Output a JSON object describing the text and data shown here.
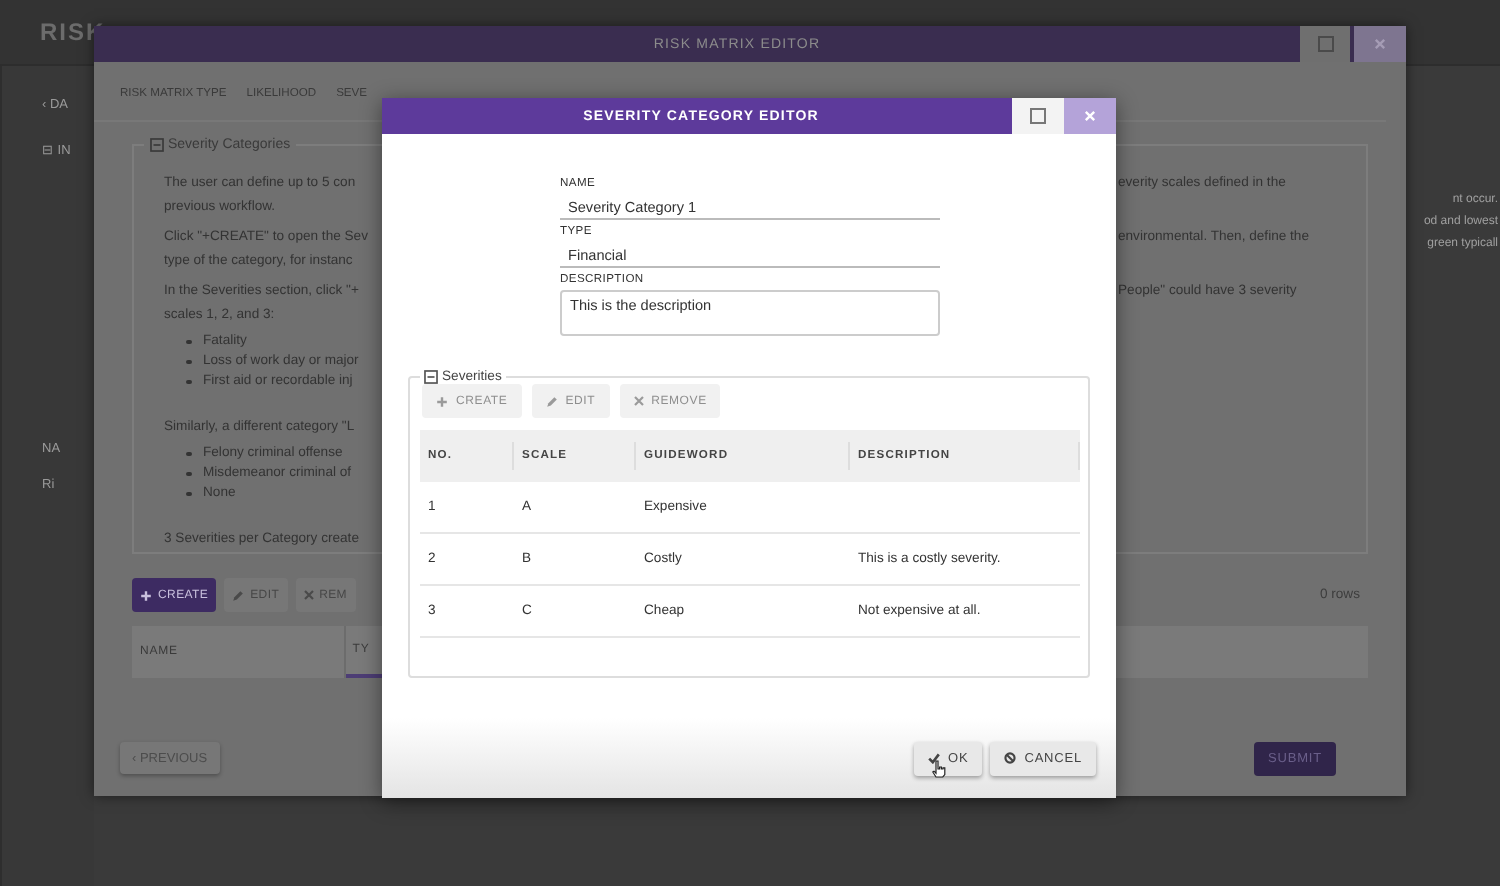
{
  "page": {
    "title": "RISK",
    "left_fragments": [
      "‹ DA",
      "⊟ IN",
      "NA",
      "Ri"
    ],
    "right_fragments": [
      "nt occur.",
      "od and lowest",
      "green typicall"
    ]
  },
  "risk_matrix_editor": {
    "title": "RISK MATRIX EDITOR",
    "tabs": [
      {
        "label": "RISK MATRIX TYPE",
        "selected": false
      },
      {
        "label": "LIKELIHOOD",
        "selected": false
      },
      {
        "label": "SEVE",
        "selected": false
      }
    ],
    "severity_categories": {
      "legend": "Severity Categories",
      "left_lines": [
        {
          "kind": "para",
          "lines": [
            "The user can define up to 5 con",
            "previous workflow."
          ]
        },
        {
          "kind": "para",
          "lines": [
            "Click \"+CREATE\" to open the Sev",
            "type of the category, for instanc"
          ]
        },
        {
          "kind": "para",
          "lines": [
            "In the Severities section, click \"+",
            "scales 1, 2, and 3:"
          ]
        },
        {
          "kind": "bullet",
          "lines": [
            "Fatality"
          ]
        },
        {
          "kind": "bullet",
          "lines": [
            "Loss of work day or major"
          ]
        },
        {
          "kind": "bullet",
          "lines": [
            "First aid or recordable inj"
          ]
        },
        {
          "kind": "para",
          "lines": [
            "Similarly, a different category \"L"
          ]
        },
        {
          "kind": "bullet",
          "lines": [
            "Felony criminal offense"
          ]
        },
        {
          "kind": "bullet",
          "lines": [
            "Misdemeanor criminal of"
          ]
        },
        {
          "kind": "bullet",
          "lines": [
            "None"
          ]
        },
        {
          "kind": "para",
          "lines": [
            "3 Severities per Category create"
          ]
        }
      ],
      "right_lines": [
        "everity scales defined in the",
        "environmental. Then, define the",
        "People\" could have 3 severity"
      ]
    },
    "toolbar": [
      {
        "kind": "create",
        "label": "CREATE",
        "disabled": false
      },
      {
        "kind": "edit",
        "label": "EDIT",
        "disabled": true
      },
      {
        "kind": "remove",
        "label": "REM",
        "disabled": true
      }
    ],
    "row_count": "0 rows",
    "columns": [
      "NAME",
      "TY"
    ],
    "previous": "‹ PREVIOUS",
    "submit": "SUBMIT"
  },
  "severity_category_editor": {
    "title": "SEVERITY CATEGORY EDITOR",
    "fields": [
      {
        "kind": "input",
        "label": "NAME",
        "value": "Severity Category 1"
      },
      {
        "kind": "input",
        "label": "TYPE",
        "value": "Financial"
      },
      {
        "kind": "textarea",
        "label": "DESCRIPTION",
        "value": "This is the description"
      }
    ],
    "severities": {
      "legend": "Severities",
      "toolbar": [
        {
          "kind": "create",
          "label": "CREATE",
          "disabled": true
        },
        {
          "kind": "edit",
          "label": "EDIT",
          "disabled": true
        },
        {
          "kind": "remove",
          "label": "REMOVE",
          "disabled": true
        }
      ],
      "columns": [
        "NO.",
        "SCALE",
        "GUIDEWORD",
        "DESCRIPTION"
      ],
      "rows": [
        {
          "no": "1",
          "scale": "A",
          "guideword": "Expensive"
        },
        {
          "no": "2",
          "scale": "B",
          "guideword": "Costly",
          "description": "This is a costly severity."
        },
        {
          "no": "3",
          "scale": "C",
          "guideword": "Cheap",
          "description": "Not expensive at all."
        }
      ]
    },
    "buttons": [
      {
        "kind": "ok",
        "label": "OK"
      },
      {
        "kind": "cancel",
        "label": "CANCEL"
      }
    ]
  }
}
